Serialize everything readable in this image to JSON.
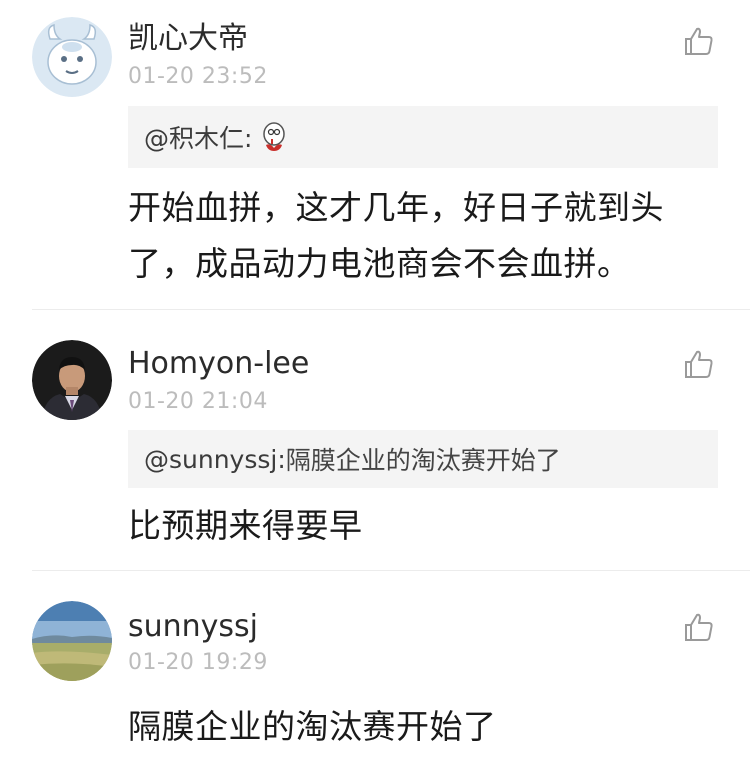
{
  "comments": [
    {
      "username": "凯心大帝",
      "timestamp": "01-20 23:52",
      "quote_user": "@积木仁:",
      "quote_text": "",
      "body_lines": [
        "开始血拼，这才几年，好日子就到头",
        "了，成品动力电池商会不会血拼。"
      ]
    },
    {
      "username": "Homyon-lee",
      "timestamp": "01-20 21:04",
      "quote_user": "@sunnyssj:",
      "quote_text": " 隔膜企业的淘汰赛开始了",
      "body_lines": [
        "比预期来得要早"
      ]
    },
    {
      "username": "sunnyssj",
      "timestamp": "01-20 19:29",
      "quote_user": "",
      "quote_text": "",
      "body_lines": [
        "隔膜企业的淘汰赛开始了"
      ]
    }
  ]
}
